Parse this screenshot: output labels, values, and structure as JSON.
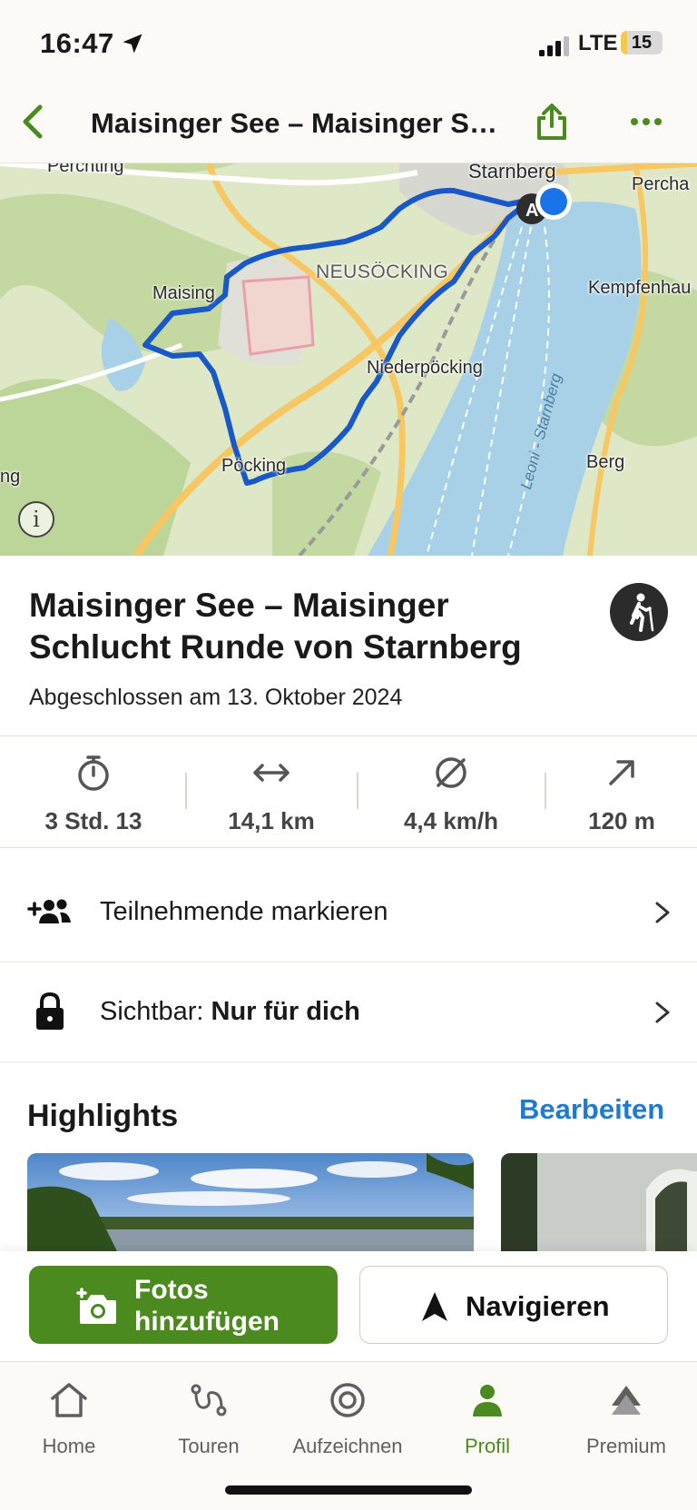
{
  "status_bar": {
    "time": "16:47",
    "network": "LTE",
    "battery": "15",
    "battery_level": 0.15
  },
  "header": {
    "title": "Maisinger See – Maisinger Schlucht Runde von Starnberg",
    "back_icon": "chevron-left-icon",
    "share_icon": "share-icon",
    "more_icon": "more-dots-icon",
    "accent_color": "#4b8a1e"
  },
  "map": {
    "labels": {
      "perchting": "Perchting",
      "starnberg": "Starnberg",
      "percha": "Percha",
      "neusoecking": "NEUSÖCKING",
      "maising": "Maising",
      "kempfenhausen": "Kempfenhau",
      "niederpoecking": "Niederpöcking",
      "leoni_starnberg": "Leoni - Starnberg",
      "poecking": "Pöcking",
      "berg": "Berg",
      "left_edge": "ng"
    },
    "start_marker": "A",
    "info_icon": "info-icon",
    "route_color": "#1858c8",
    "lake_color": "#a8d1e8"
  },
  "tour": {
    "title": "Maisinger See – Maisinger Schlucht Runde von Starnberg",
    "completed": "Abgeschlossen am 13. Oktober 2024",
    "sport_icon": "hiking-icon"
  },
  "stats": [
    {
      "icon": "stopwatch-icon",
      "value": "3 Std. 13"
    },
    {
      "icon": "distance-icon",
      "value": "14,1 km"
    },
    {
      "icon": "average-speed-icon",
      "value": "4,4 km/h"
    },
    {
      "icon": "uphill-icon",
      "value": "120 m"
    }
  ],
  "rows": {
    "participants": {
      "label": "Teilnehmende markieren",
      "icon": "add-people-icon"
    },
    "visibility": {
      "prefix": "Sichtbar: ",
      "value": "Nur für dich",
      "icon": "lock-icon"
    }
  },
  "highlights": {
    "title": "Highlights",
    "edit": "Bearbeiten",
    "edit_color": "#1f7ad1"
  },
  "actions": {
    "photos": "Fotos hinzufügen",
    "navigate": "Navigieren"
  },
  "tabs": [
    {
      "label": "Home",
      "icon": "home-icon"
    },
    {
      "label": "Touren",
      "icon": "tours-icon"
    },
    {
      "label": "Aufzeichnen",
      "icon": "record-icon"
    },
    {
      "label": "Profil",
      "icon": "profile-icon",
      "active": true
    },
    {
      "label": "Premium",
      "icon": "premium-icon"
    }
  ]
}
